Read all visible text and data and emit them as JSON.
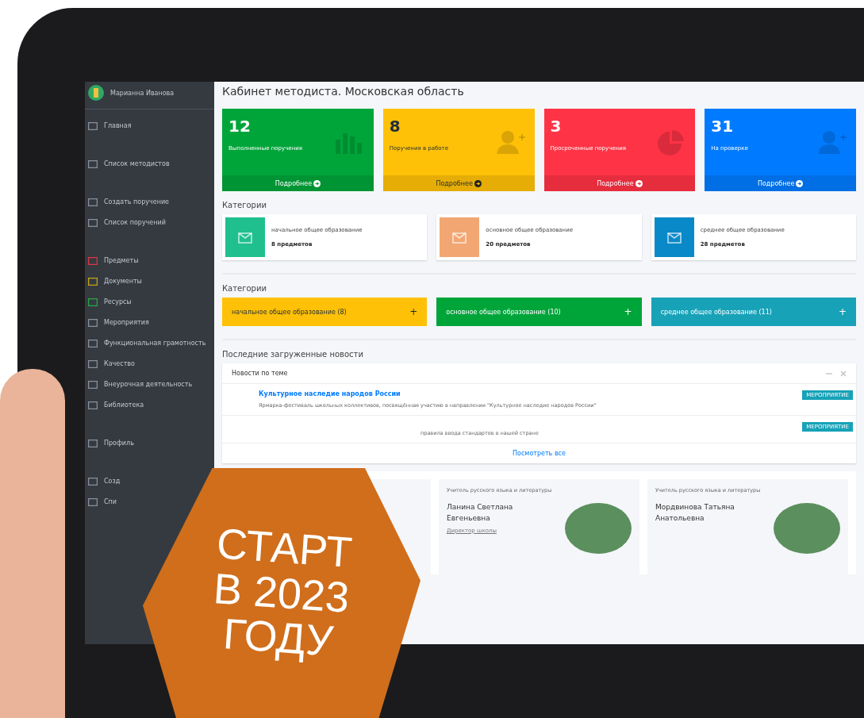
{
  "sidebar": {
    "brand": "Марианна Иванова",
    "items": [
      {
        "label": "Главная",
        "color": "#8a9099"
      },
      {
        "label": "Список методистов",
        "color": "#8a9099"
      },
      {
        "label": "Создать поручение",
        "color": "#8a9099"
      },
      {
        "label": "Список поручений",
        "color": "#8a9099"
      },
      {
        "label": "Предметы",
        "color": "#dc3545"
      },
      {
        "label": "Документы",
        "color": "#c8a415"
      },
      {
        "label": "Ресурсы",
        "color": "#28a745"
      },
      {
        "label": "Мероприятия",
        "color": "#8a9099"
      },
      {
        "label": "Функциональная грамотность",
        "color": "#8a9099"
      },
      {
        "label": "Качество",
        "color": "#8a9099"
      },
      {
        "label": "Внеурочная деятельность",
        "color": "#8a9099"
      },
      {
        "label": "Библиотека",
        "color": "#8a9099"
      },
      {
        "label": "Профиль",
        "color": "#8a9099"
      },
      {
        "label": "Созд",
        "color": "#8a9099"
      },
      {
        "label": "Спи",
        "color": "#8a9099"
      }
    ]
  },
  "page_title": "Кабинет методиста. Московская область",
  "stats": [
    {
      "value": "12",
      "label": "Выполненные поручения",
      "link": "Подробнее",
      "color": "#00a53a",
      "kind": "chart"
    },
    {
      "value": "8",
      "label": "Поручения в работе",
      "link": "Подробнее",
      "color": "#ffc107",
      "kind": "user"
    },
    {
      "value": "3",
      "label": "Просроченные поручения",
      "link": "Подробнее",
      "color": "#ff3346",
      "kind": "pie"
    },
    {
      "value": "31",
      "label": "На проверке",
      "link": "Подробнее",
      "color": "#007bff",
      "kind": "user"
    }
  ],
  "categories": {
    "title": "Категории",
    "items": [
      {
        "name": "начальное общее образование",
        "count": "8 предметов",
        "color": "#1fc08e"
      },
      {
        "name": "основное общее образование",
        "count": "20 предметов",
        "color": "#f2a773"
      },
      {
        "name": "среднее общее образование",
        "count": "28 предметов",
        "color": "#0a89c9"
      }
    ]
  },
  "category_buttons": {
    "title": "Категории",
    "items": [
      {
        "label": "начальное общее образование (8)",
        "color": "#ffc107"
      },
      {
        "label": "основное общее образование (10)",
        "color": "#00a53a"
      },
      {
        "label": "среднее общее образование (11)",
        "color": "#17a2b8"
      }
    ],
    "plus": "+"
  },
  "news": {
    "title": "Последние загруженные новости",
    "card_title": "Новости по теме",
    "items": [
      {
        "title": "Культурное наследие народов России",
        "text": "Ярмарка-фестиваль школьных коллективов, посвящённая участию в направлении \"Культурное наследие народов России\"",
        "badge": "МЕРОПРИЯТИЕ"
      },
      {
        "text": "правила ввода стандартов в нашей стране",
        "badge": "МЕРОПРИЯТИЕ"
      }
    ],
    "more": "Посмотреть все"
  },
  "teachers": [
    {
      "role": "Учитель русского языка и литературы",
      "name": "Ланина Светлана Евгеньевна",
      "note": "Директор школы"
    },
    {
      "role": "Учитель русского языка и литературы",
      "name": "Мордвинова Татьяна Анатольевна"
    }
  ],
  "promo": [
    "СТАРТ",
    "В 2023",
    "ГОДУ"
  ]
}
